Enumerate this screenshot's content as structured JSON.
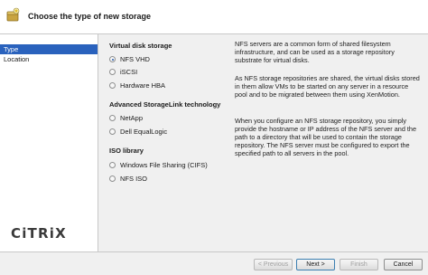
{
  "header": {
    "title": "Choose the type of new storage",
    "icon": "storage-wizard-icon"
  },
  "sidebar": {
    "items": [
      {
        "label": "Type",
        "active": true
      },
      {
        "label": "Location",
        "active": false
      }
    ]
  },
  "logo": {
    "text": "CiTRiX"
  },
  "groups": {
    "virtual_disk": {
      "title": "Virtual disk storage",
      "options": [
        {
          "label": "NFS VHD",
          "checked": true
        },
        {
          "label": "iSCSI",
          "checked": false
        },
        {
          "label": "Hardware HBA",
          "checked": false
        }
      ]
    },
    "advanced": {
      "title": "Advanced StorageLink technology",
      "options": [
        {
          "label": "NetApp",
          "checked": false
        },
        {
          "label": "Dell EqualLogic",
          "checked": false
        }
      ]
    },
    "iso": {
      "title": "ISO library",
      "options": [
        {
          "label": "Windows File Sharing (CIFS)",
          "checked": false
        },
        {
          "label": "NFS ISO",
          "checked": false
        }
      ]
    }
  },
  "description": {
    "p1": "NFS servers are a common form of shared filesystem infrastructure, and can be used as a storage repository substrate for virtual disks.",
    "p2": "As NFS storage repositories are shared, the virtual disks stored in them allow VMs to be started on any server in a resource pool and to be migrated between them using XenMotion.",
    "p3": "When you configure an NFS storage repository, you simply provide the hostname or IP address of the NFS server and the path to a directory that will be used to contain the storage repository. The NFS server must be configured to export the specified path to all servers in the pool."
  },
  "buttons": {
    "previous": "< Previous",
    "next": "Next >",
    "finish": "Finish",
    "cancel": "Cancel"
  }
}
